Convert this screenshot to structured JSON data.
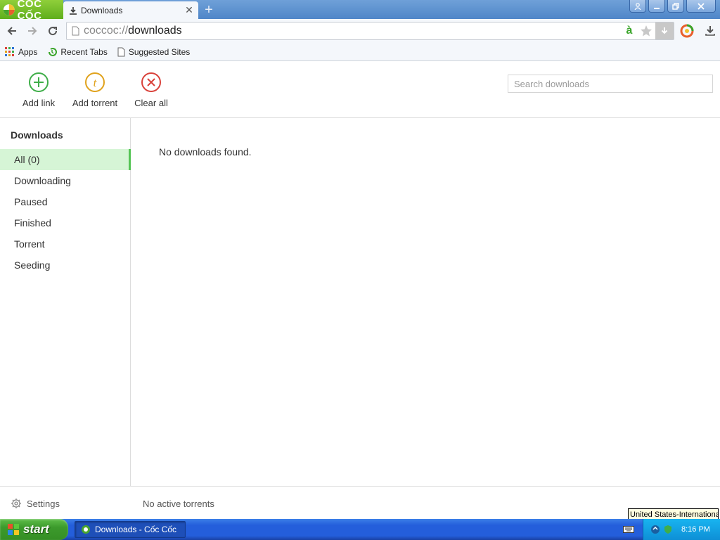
{
  "browser": {
    "brand": "CỐC CỐC",
    "tab": {
      "title": "Downloads"
    },
    "address": {
      "scheme": "coccoc://",
      "host": "downloads"
    }
  },
  "bookmarks": [
    {
      "label": "Apps",
      "icon": "apps-grid-icon"
    },
    {
      "label": "Recent Tabs",
      "icon": "history-icon"
    },
    {
      "label": "Suggested Sites",
      "icon": "page-icon"
    }
  ],
  "actions": {
    "add_link": "Add link",
    "add_torrent": "Add torrent",
    "clear_all": "Clear all"
  },
  "search": {
    "placeholder": "Search downloads"
  },
  "sidebar": {
    "title": "Downloads",
    "items": [
      {
        "label": "All (0)",
        "active": true
      },
      {
        "label": "Downloading"
      },
      {
        "label": "Paused"
      },
      {
        "label": "Finished"
      },
      {
        "label": "Torrent"
      },
      {
        "label": "Seeding"
      }
    ]
  },
  "main": {
    "empty_message": "No downloads found."
  },
  "footer": {
    "settings": "Settings",
    "torrent_status": "No active torrents"
  },
  "tooltip": "United States-International",
  "taskbar": {
    "start": "start",
    "window": "Downloads - Cốc Cốc",
    "clock": "8:16 PM"
  },
  "colors": {
    "accent_green": "#55c455",
    "active_item_bg": "#d6f5d6",
    "add_link": "#3fae49",
    "add_torrent": "#e0a21c",
    "clear_all": "#d9413a"
  }
}
